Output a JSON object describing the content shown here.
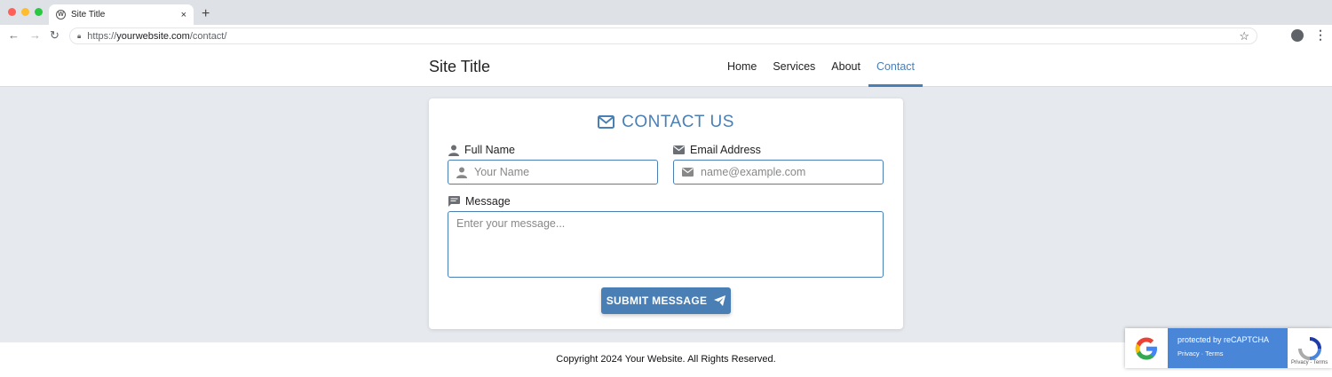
{
  "browser": {
    "tab_title": "Site Title",
    "tab_close": "×",
    "new_tab": "+",
    "url_prefix": "https://",
    "url_host": "yourwebsite.com",
    "url_path": "/contact/"
  },
  "header": {
    "site_title": "Site Title",
    "nav": [
      {
        "label": "Home"
      },
      {
        "label": "Services"
      },
      {
        "label": "About"
      },
      {
        "label": "Contact",
        "active": true
      }
    ]
  },
  "form": {
    "title": "CONTACT US",
    "name_label": "Full Name",
    "name_placeholder": "Your Name",
    "email_label": "Email Address",
    "email_placeholder": "name@example.com",
    "message_label": "Message",
    "message_placeholder": "Enter your message...",
    "submit_label": "SUBMIT MESSAGE"
  },
  "footer": {
    "copyright": "Copyright 2024 Your Website. All Rights Reserved."
  },
  "recaptcha": {
    "protected_text": "protected by reCAPTCHA",
    "links": "Privacy · Terms",
    "terms_small": "Privacy - Terms"
  },
  "colors": {
    "accent": "#4a7fb5",
    "recaptcha_blue": "#4a86d8",
    "page_bg": "#e6e9ed"
  }
}
